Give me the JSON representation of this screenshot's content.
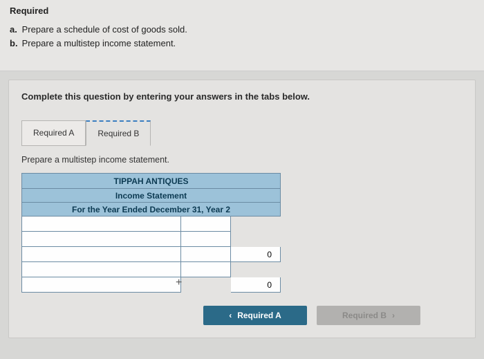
{
  "header": {
    "title": "Required",
    "items": [
      {
        "letter": "a.",
        "text": "Prepare a schedule of cost of goods sold."
      },
      {
        "letter": "b.",
        "text": "Prepare a multistep income statement."
      }
    ]
  },
  "panel": {
    "instruction": "Complete this question by entering your answers in the tabs below.",
    "tabs": [
      {
        "label": "Required A",
        "active": false
      },
      {
        "label": "Required B",
        "active": true
      }
    ],
    "tab_description": "Prepare a multistep income statement.",
    "sheet_header": {
      "line1": "TIPPAH ANTIQUES",
      "line2": "Income Statement",
      "line3": "For the Year Ended December 31, Year 2"
    },
    "rows": [
      {
        "label": "",
        "col1": "",
        "col2": null
      },
      {
        "label": "",
        "col1": "",
        "col2": null
      },
      {
        "label": "",
        "col1": "",
        "col2": "0"
      },
      {
        "label": "",
        "col1": "",
        "col2": null
      },
      {
        "label": "",
        "col1": null,
        "col2": "0"
      }
    ],
    "nav": {
      "prev_label": "Required A",
      "next_label": "Required B"
    }
  }
}
